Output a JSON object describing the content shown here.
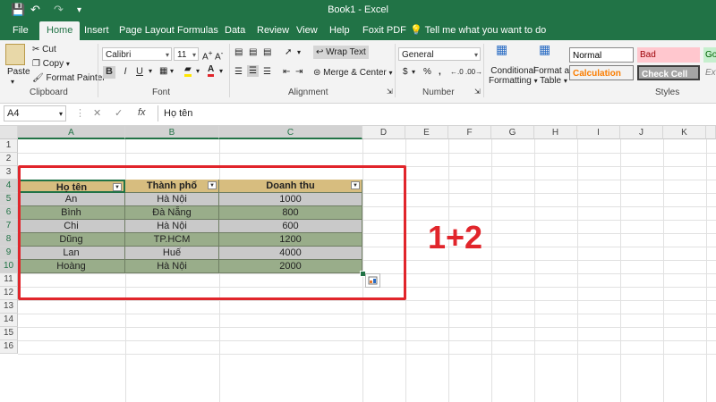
{
  "window": {
    "title": "Book1 - Excel"
  },
  "tabs": [
    "File",
    "Home",
    "Insert",
    "Page Layout",
    "Formulas",
    "Data",
    "Review",
    "View",
    "Help",
    "Foxit PDF"
  ],
  "tell_me": "Tell me what you want to do",
  "clipboard": {
    "paste": "Paste",
    "cut": "Cut",
    "copy": "Copy",
    "format_painter": "Format Painter",
    "label": "Clipboard"
  },
  "font": {
    "name": "Calibri",
    "size": "11",
    "label": "Font",
    "bold": "B",
    "italic": "I",
    "underline": "U"
  },
  "alignment": {
    "wrap_text": "Wrap Text",
    "merge_center": "Merge & Center",
    "label": "Alignment"
  },
  "number": {
    "format": "General",
    "label": "Number",
    "currency": "$",
    "percent": "%",
    "comma": ","
  },
  "styles": {
    "conditional": "Conditional",
    "conditional2": "Formatting",
    "format_as": "Format as",
    "format_as2": "Table",
    "normal": "Normal",
    "bad": "Bad",
    "good": "Go",
    "calculation": "Calculation",
    "check_cell": "Check Cell",
    "explanatory": "Ex",
    "label": "Styles"
  },
  "formula_bar": {
    "name_box": "A4",
    "content": "Họ tên",
    "fx": "fx"
  },
  "columns": [
    "A",
    "B",
    "C",
    "D",
    "E",
    "F",
    "G",
    "H",
    "I",
    "J",
    "K"
  ],
  "rows": [
    "1",
    "2",
    "3",
    "4",
    "5",
    "6",
    "7",
    "8",
    "9",
    "10",
    "11",
    "12",
    "13",
    "14",
    "15",
    "16"
  ],
  "table": {
    "headers": [
      "Họ tên",
      "Thành phố",
      "Doanh thu"
    ],
    "rows": [
      [
        "An",
        "Hà Nội",
        "1000"
      ],
      [
        "Bình",
        "Đà Nẵng",
        "800"
      ],
      [
        "Chi",
        "Hà Nội",
        "600"
      ],
      [
        "Dũng",
        "TP.HCM",
        "1200"
      ],
      [
        "Lan",
        "Huế",
        "4000"
      ],
      [
        "Hoàng",
        "Hà Nội",
        "2000"
      ]
    ]
  },
  "annotation": "1+2",
  "colors": {
    "excel_green": "#217346",
    "header_fill": "#d7bd7f",
    "band_gray": "#c9c9c9",
    "band_green": "#99ad8a",
    "highlight_red": "#e1252b"
  }
}
